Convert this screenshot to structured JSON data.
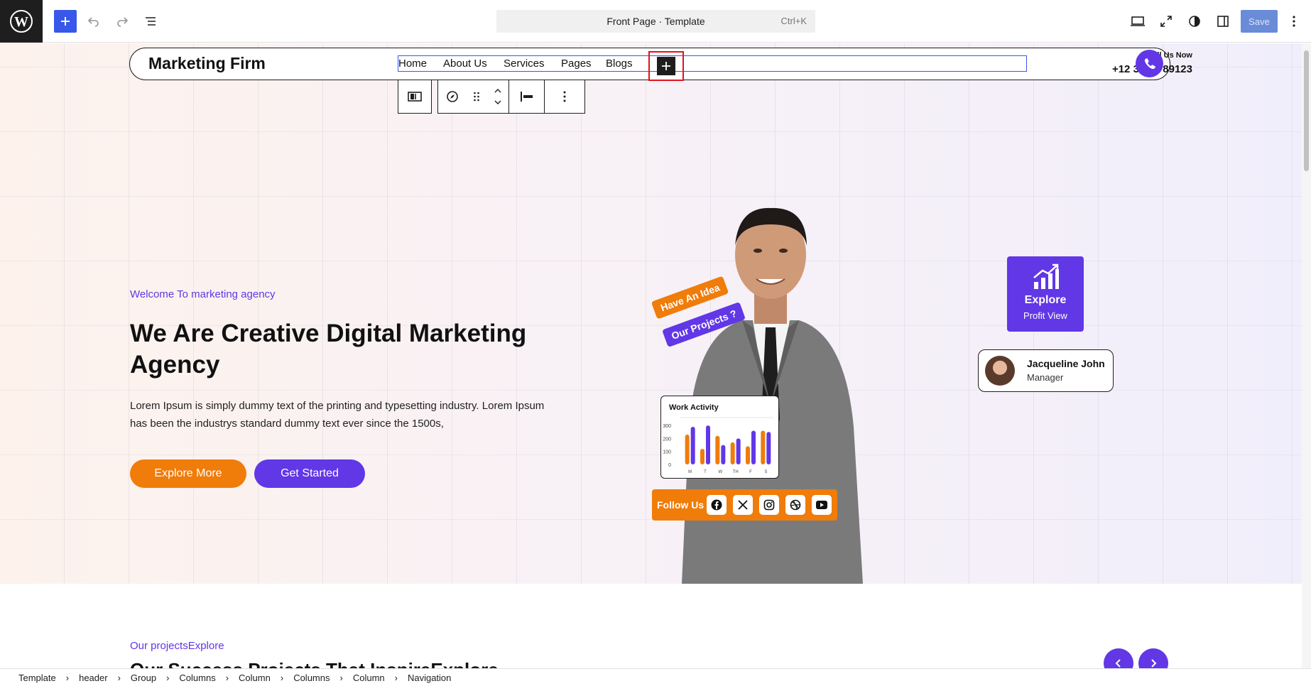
{
  "toolbar": {
    "command_title": "Front Page · Template",
    "command_shortcut": "Ctrl+K",
    "save_label": "Save"
  },
  "site_header": {
    "brand": "Marketing Firm",
    "nav": [
      "Home",
      "About Us",
      "Services",
      "Pages",
      "Blogs"
    ],
    "call_label": "Call Us Now",
    "call_number": "+12 3456789123"
  },
  "hero": {
    "welcome": "Welcome To marketing agency",
    "title": "We Are Creative Digital Marketing Agency",
    "text": "Lorem Ipsum is simply dummy text of the printing and typesetting industry. Lorem Ipsum has been the industrys standard dummy text ever since the 1500s,",
    "explore_btn": "Explore More",
    "start_btn": "Get Started",
    "tag_idea": "Have An Idea",
    "tag_projects": "Our Projects ?",
    "explore_card_title": "Explore",
    "explore_card_sub": "Profit View",
    "profile_name": "Jacqueline John",
    "profile_role": "Manager",
    "follow_label": "Follow Us"
  },
  "chart_data": {
    "type": "bar",
    "title": "Work Activity",
    "categories": [
      "M",
      "T",
      "W",
      "TH",
      "F",
      "S"
    ],
    "yticks": [
      "300",
      "200",
      "100",
      "0"
    ],
    "ylim": [
      0,
      350
    ],
    "series": [
      {
        "color": "#f07c0a",
        "values": [
          230,
          120,
          220,
          170,
          140,
          260
        ]
      },
      {
        "color": "#6137e6",
        "values": [
          290,
          300,
          150,
          200,
          260,
          250
        ]
      }
    ]
  },
  "projects": {
    "subtitle": "Our projectsExplore",
    "title": "Our Success Projects That InspireExplore"
  },
  "breadcrumb": [
    "Template",
    "header",
    "Group",
    "Columns",
    "Column",
    "Columns",
    "Column",
    "Navigation"
  ],
  "colors": {
    "accent": "#6137e6",
    "orange": "#f07c0a",
    "wp_blue": "#3858e9",
    "selection_red": "#e1131b"
  }
}
